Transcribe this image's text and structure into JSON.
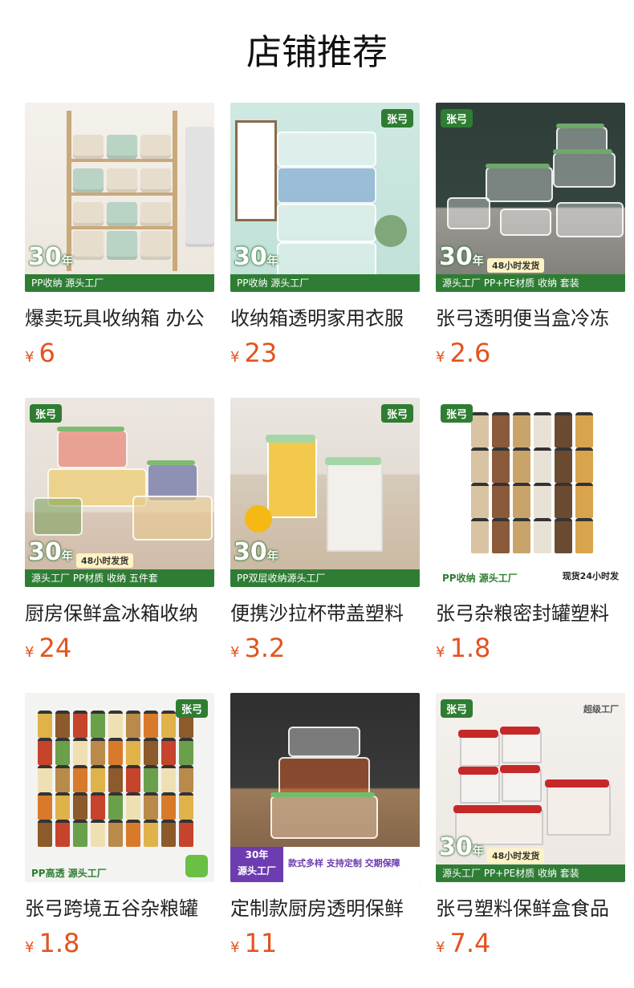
{
  "section": {
    "title": "店铺推荐"
  },
  "products": [
    {
      "name": "爆卖玩具收纳箱 办公",
      "currency": "¥",
      "price": "6",
      "badge": {
        "years": "30",
        "unit": "年",
        "strip": "PP收纳  源头工厂"
      }
    },
    {
      "name": "收纳箱透明家用衣服",
      "currency": "¥",
      "price": "23",
      "badge": {
        "years": "30",
        "unit": "年",
        "strip": "PP收纳  源头工厂"
      }
    },
    {
      "name": "张弓透明便当盒冷冻",
      "currency": "¥",
      "price": "2.6",
      "badge": {
        "years": "30",
        "unit": "年",
        "tag": "48小时发货",
        "strip": "源头工厂   PP+PE材质 收纳 套装"
      }
    },
    {
      "name": "厨房保鲜盒冰箱收纳",
      "currency": "¥",
      "price": "24",
      "badge": {
        "years": "30",
        "unit": "年",
        "tag": "48小时发货",
        "strip": "源头工厂   PP材质 收纳 五件套"
      }
    },
    {
      "name": "便携沙拉杯带盖塑料",
      "currency": "¥",
      "price": "3.2",
      "badge": {
        "years": "30",
        "unit": "年",
        "strip": "PP双层收纳源头工厂"
      }
    },
    {
      "name": "张弓杂粮密封罐塑料",
      "currency": "¥",
      "price": "1.8",
      "badge": {
        "strip": "PP收纳  源头工厂",
        "side": "现货24小时发"
      }
    },
    {
      "name": "张弓跨境五谷杂粮罐",
      "currency": "¥",
      "price": "1.8",
      "badge": {
        "strip": "PP高透  源头工厂"
      }
    },
    {
      "name": "定制款厨房透明保鲜",
      "currency": "¥",
      "price": "11",
      "badge": {
        "years": "30年",
        "sub": "源头工厂",
        "right": "款式多样  支持定制  交期保障"
      }
    },
    {
      "name": "张弓塑料保鲜盒食品",
      "currency": "¥",
      "price": "7.4",
      "badge": {
        "years": "30",
        "unit": "年",
        "tag": "48小时发货",
        "strip": "源头工厂   PP+PE材质 收纳 套装",
        "top": "超级工厂"
      }
    }
  ],
  "brand_label": "张弓",
  "colors": {
    "price": "#e4531e",
    "brand_green": "#2e7d32",
    "purple": "#6d3cb0"
  }
}
